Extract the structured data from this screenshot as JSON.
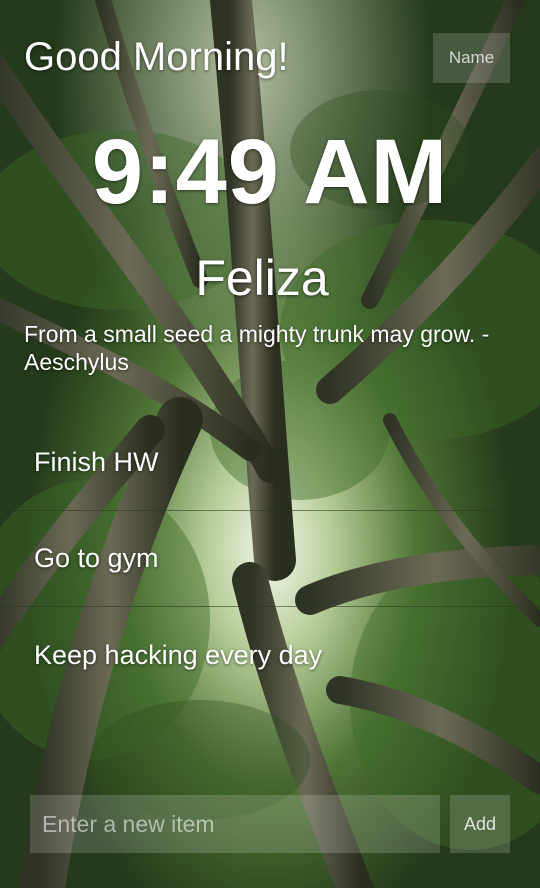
{
  "header": {
    "greeting": "Good Morning!",
    "name_button": "Name"
  },
  "clock": {
    "time": "9:49 AM"
  },
  "user": {
    "name": "Feliza"
  },
  "quote": {
    "text": "From a small seed a mighty trunk may grow. - Aeschylus"
  },
  "todos": [
    {
      "label": "Finish HW"
    },
    {
      "label": "Go to gym"
    },
    {
      "label": "Keep hacking every day"
    }
  ],
  "new_item": {
    "placeholder": "Enter a new item",
    "value": "",
    "add_label": "Add"
  },
  "colors": {
    "foliage_dark": "#1f3417",
    "foliage_light": "#8fb06a",
    "sky": "#eef3e6",
    "bamboo": "#5d5a46"
  }
}
